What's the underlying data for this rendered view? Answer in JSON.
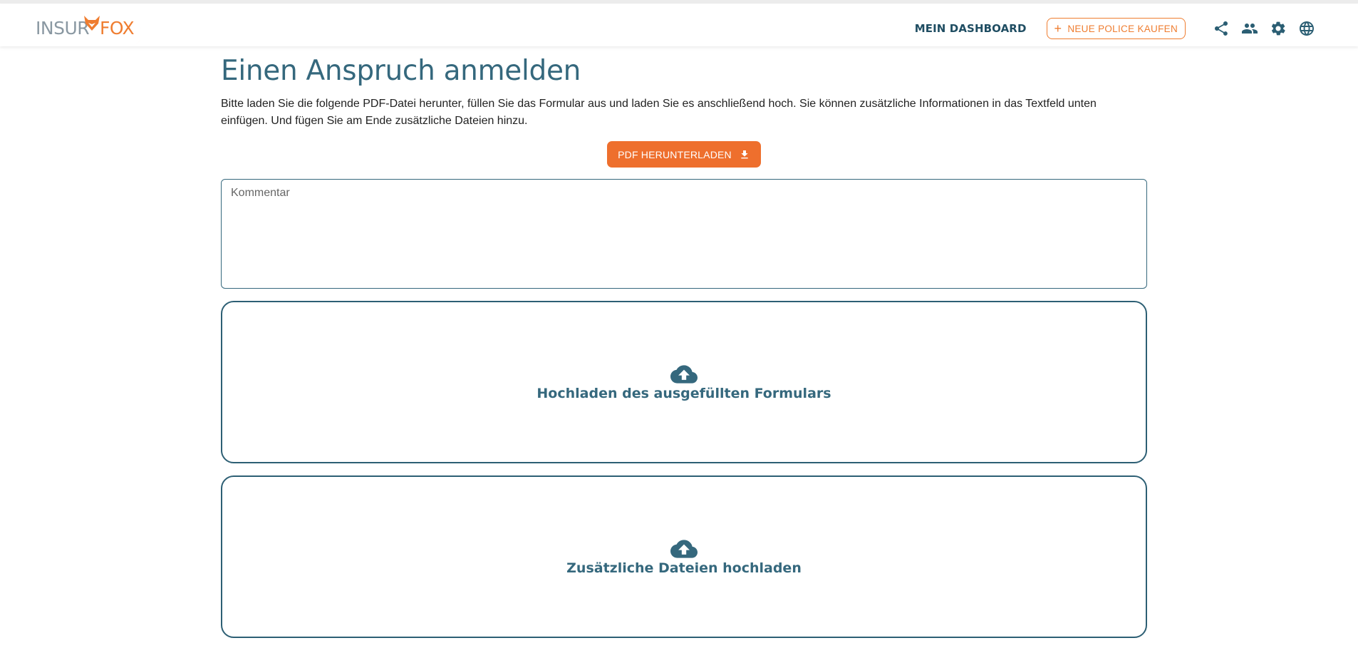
{
  "header": {
    "logo": {
      "part1": "INSUR",
      "part2": "FOX"
    },
    "nav": {
      "dashboard": "MEIN DASHBOARD",
      "buy_plus": "+",
      "buy_policy": "NEUE POLICE KAUFEN"
    },
    "icons": [
      "share-icon",
      "people-icon",
      "gear-icon",
      "globe-icon"
    ]
  },
  "main": {
    "title": "Einen Anspruch anmelden",
    "description": "Bitte laden Sie die folgende PDF-Datei herunter, füllen Sie das Formular aus und laden Sie es anschließend hoch. Sie können zusätzliche Informationen in das Textfeld unten einfügen. Und fügen Sie am Ende zusätzliche Dateien hinzu.",
    "download_button": "PDF HERUNTERLADEN",
    "comment": {
      "value": "",
      "placeholder": "Kommentar"
    },
    "upload_form_label": "Hochladen des ausgefüllten Formulars",
    "upload_additional_label": "Zusätzliche Dateien hochladen"
  },
  "colors": {
    "primary": "#35687d",
    "accent": "#ee6f2d",
    "nav_text": "#1f4d62"
  }
}
